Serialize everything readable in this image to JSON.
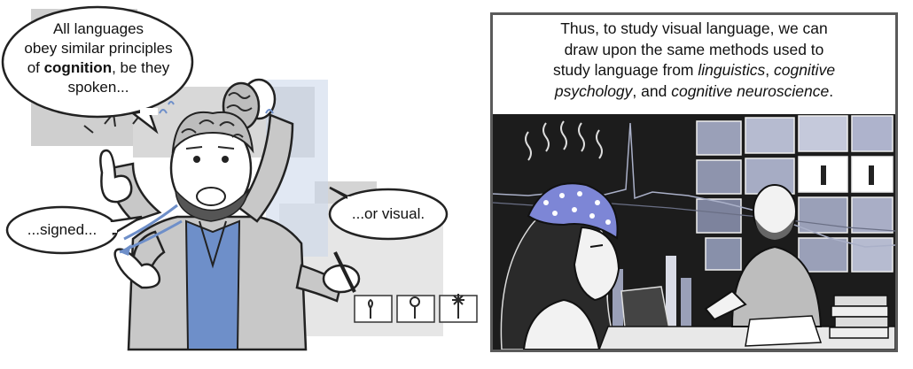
{
  "left_panel": {
    "bubble_spoken": {
      "line1": "All languages",
      "line2": "obey similar principles",
      "line3_pre": "of ",
      "line3_bold": "cognition",
      "line3_post": ", be they",
      "line4": "spoken..."
    },
    "bubble_signed": "...signed...",
    "bubble_visual": "...or visual."
  },
  "right_panel": {
    "caption": {
      "line1": "Thus, to study visual language, we can",
      "line2": "draw upon the same methods used to",
      "line3_pre": "study language from ",
      "line3_em1": "linguistics",
      "line3_mid": ", ",
      "line3_em2": "cognitive",
      "line4_em": "psychology",
      "line4_mid": ", and ",
      "line4_em2": "cognitive neuroscience",
      "line4_post": "."
    }
  },
  "colors": {
    "ink": "#111111",
    "grey_block": "#cfcfcf",
    "eeg_cap": "#7d86d6",
    "shirt_blue": "#6e8fc9",
    "dark_scene": "#1c1c1c"
  }
}
